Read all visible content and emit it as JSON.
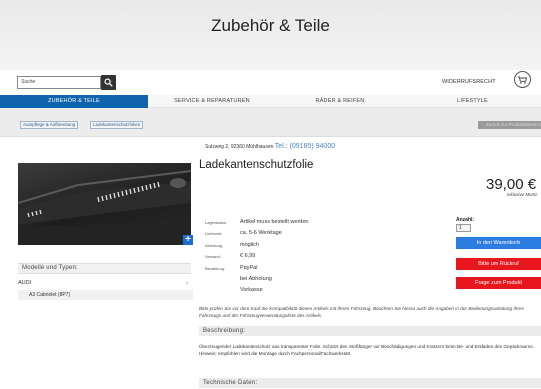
{
  "header": {
    "site_title": "Zubehör & Teile",
    "search_placeholder": "Suche",
    "wishlist_label": "WIDERRUFSRECHT"
  },
  "nav": {
    "items": [
      "ZUBEHÖR & TEILE",
      "SERVICE & REPARATUREN",
      "RÄDER & REIFEN",
      "LIFESTYLE"
    ],
    "active_color": "#0f64ad"
  },
  "breadcrumbs": [
    "Autopflege & Aufbereitung",
    "Ladekantenschutzfolien"
  ],
  "back_button": "Zurück zur Produktübersicht",
  "store": {
    "address": "Sulzweg 2, 92360 Mühlhausen",
    "phone": "Tel.: (09185) 94000"
  },
  "product": {
    "title": "Ladekantenschutzfolie",
    "price": "39,00 €",
    "price_note": "inklusive MwSt.",
    "specs": [
      {
        "key": "Lagerstatus:",
        "values": [
          "Artikel muss bestellt werden"
        ]
      },
      {
        "key": "Lieferzeit:",
        "values": [
          "ca. 5-6 Werktage"
        ]
      },
      {
        "key": "Abholung:",
        "values": [
          "möglich"
        ]
      },
      {
        "key": "Versand:",
        "values": [
          "€ 6,99"
        ]
      },
      {
        "key": "Bezahlung:",
        "values": [
          "PayPal",
          "bei Abholung",
          "Vorkasse"
        ]
      }
    ],
    "quantity_label": "Anzahl:",
    "quantity_value": "1",
    "buttons": {
      "add_to_cart": "In den Warenkorb",
      "callback": "Bitte um Rückruf",
      "inquiry": "Frage zum Produkt"
    }
  },
  "models": {
    "header": "Modelle und Typen:",
    "brand": "AUDI",
    "model": "A3 Cabriolet (8P7)"
  },
  "compat_note": "Bitte prüfen Sie vor dem Kauf die Kompatibilität dieses Artikels mit Ihrem Fahrzeug. Beachten Sie hierzu auch die Angaben in der Bedienungsanleitung Ihres Fahrzeugs und der Fahrzeugverwendungsliste des Artikels.",
  "description": {
    "header": "Beschreibung:",
    "text": "Überzeugender Ladekantenschutz aus transparenter Folie. Schützt den Stoßfänger vor Beschädigungen und Kratzern beim Be- und Entladen des Gepäckraums. Hinweis: empfohlen wird die Montage durch Fachpersonal/Fachwerkstatt"
  },
  "tech_header": "Technische Daten:",
  "colors": {
    "accent_blue": "#2b7de2",
    "accent_red": "#e8161d",
    "phone_blue": "#4b84c4"
  },
  "icons": [
    "search-icon",
    "cart-icon",
    "plus-icon",
    "chevron-right-icon"
  ]
}
